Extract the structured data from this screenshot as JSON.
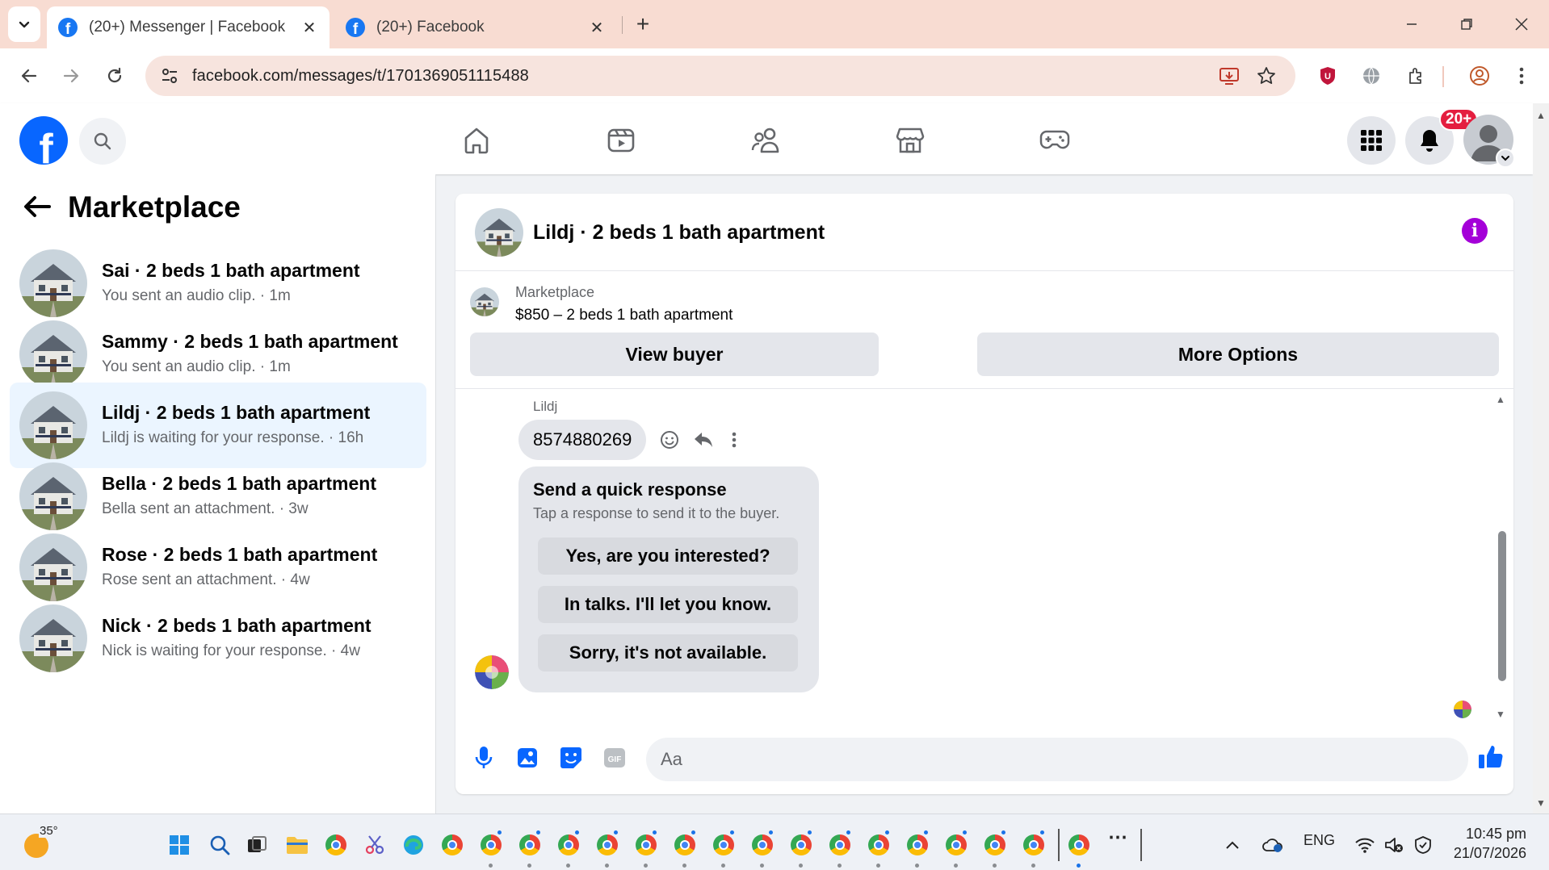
{
  "browser": {
    "tabs": [
      {
        "title": "(20+) Messenger | Facebook",
        "active": true
      },
      {
        "title": "(20+) Facebook",
        "active": false
      }
    ],
    "new_tab_label": "+",
    "url": "facebook.com/messages/t/1701369051115488"
  },
  "fb_header": {
    "logo_letter": "f",
    "notification_badge": "20+",
    "nav_icons": [
      "home-icon",
      "video-icon",
      "friends-icon",
      "marketplace-icon",
      "gaming-icon"
    ]
  },
  "sidebar": {
    "title": "Marketplace",
    "conversations": [
      {
        "name": "Sai · 2 beds 1 bath apartment",
        "preview": "You sent an audio clip. · 1m",
        "selected": false
      },
      {
        "name": "Sammy · 2 beds 1 bath apartment",
        "preview": "You sent an audio clip. · 1m",
        "selected": false
      },
      {
        "name": "Lildj · 2 beds 1 bath apartment",
        "preview": "Lildj is waiting for your response. · 16h",
        "selected": true
      },
      {
        "name": "Bella · 2 beds 1 bath apartment",
        "preview": "Bella sent an attachment. · 3w",
        "selected": false
      },
      {
        "name": "Rose · 2 beds 1 bath apartment",
        "preview": "Rose sent an attachment. · 4w",
        "selected": false
      },
      {
        "name": "Nick · 2 beds 1 bath apartment",
        "preview": "Nick is waiting for your response. · 4w",
        "selected": false
      }
    ]
  },
  "chat": {
    "title": "Lildj · 2 beds 1 bath apartment",
    "listing": {
      "source": "Marketplace",
      "item": "$850 – 2 beds 1 bath apartment",
      "view_buyer_label": "View buyer",
      "more_options_label": "More Options"
    },
    "sender_name": "Lildj",
    "message_text": "8574880269",
    "quick_response": {
      "heading": "Send a quick response",
      "description": "Tap a response to send it to the buyer.",
      "options": [
        "Yes, are you interested?",
        "In talks. I'll let you know.",
        "Sorry, it's not available."
      ]
    },
    "composer": {
      "placeholder": "Aa"
    }
  },
  "taskbar": {
    "weather_temp": "35°",
    "tray_language": "ENG",
    "time": "10:45 pm",
    "date": "21/07/2026"
  },
  "colors": {
    "tabbar_bg": "#f8dcd2",
    "fb_blue": "#0866ff",
    "selected_conv_bg": "#ebf5ff",
    "info_purple": "#a400d8",
    "badge_red": "#e41e3f"
  }
}
